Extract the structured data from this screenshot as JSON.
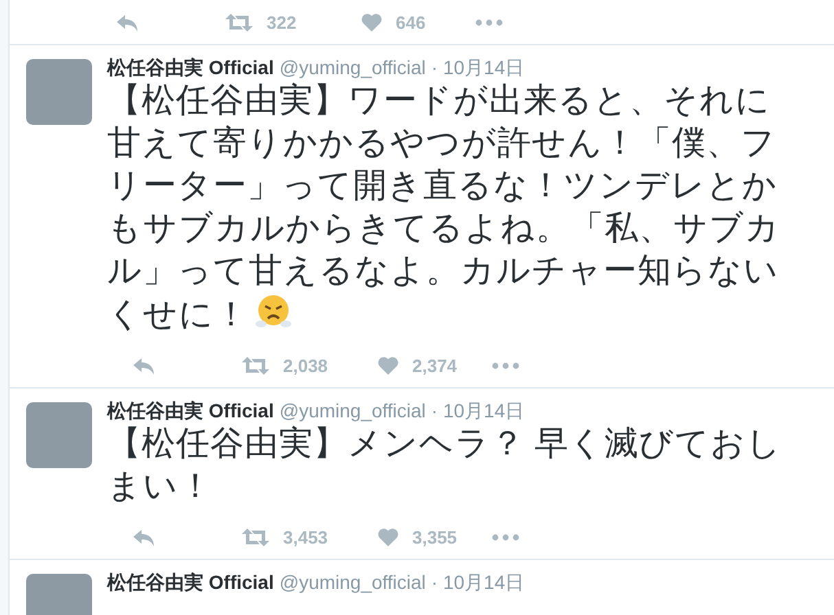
{
  "timeline": [
    {
      "retweets": "322",
      "likes": "646"
    },
    {
      "author": "松任谷由実 Official",
      "handle": "@yuming_official",
      "date": "· 10月14日",
      "text": "【松任谷由実】ワードが出来ると、それに甘えて寄りかかるやつが許せん！「僕、フリーター」って開き直るな！ツンデレとかもサブカルからきてるよね。「私、サブカル」って甘えるなよ。カルチャー知らないくせに！",
      "retweets": "2,038",
      "likes": "2,374"
    },
    {
      "author": "松任谷由実 Official",
      "handle": "@yuming_official",
      "date": "· 10月14日",
      "text": "【松任谷由実】メンヘラ？ 早く滅びておしまい！",
      "retweets": "3,453",
      "likes": "3,355"
    },
    {
      "author": "松任谷由実 Official",
      "handle": "@yuming_official",
      "date": "· 10月14日"
    }
  ]
}
